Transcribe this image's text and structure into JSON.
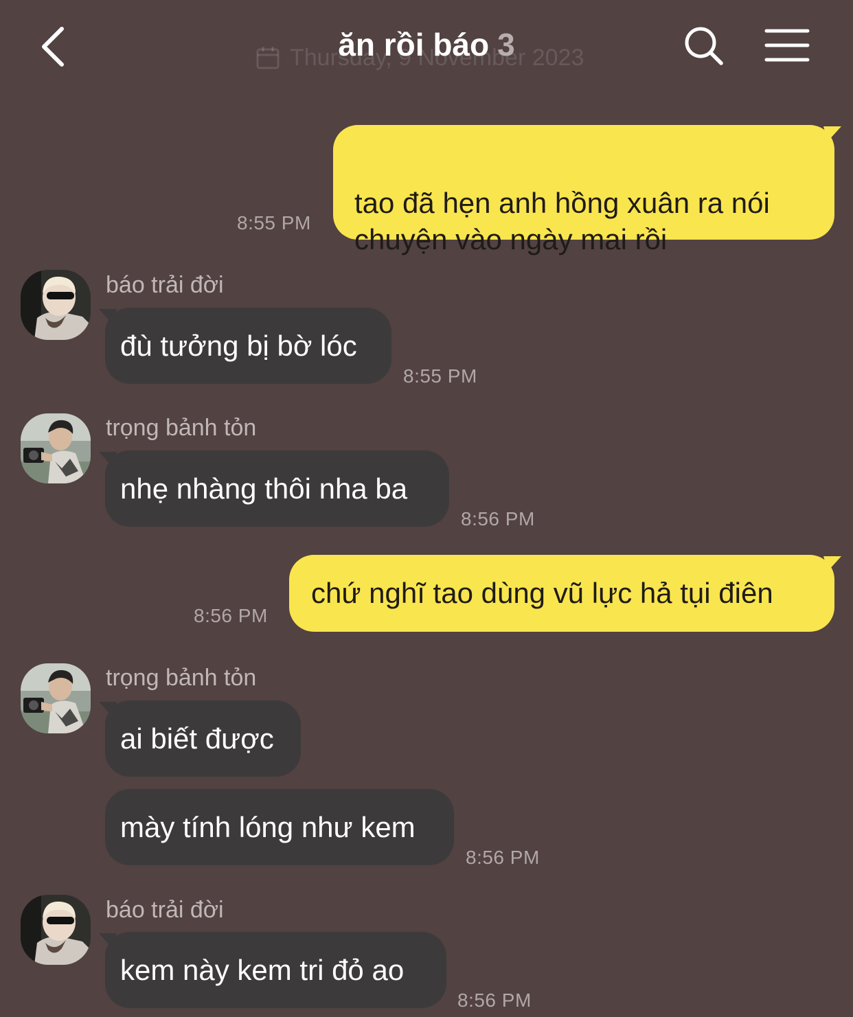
{
  "header": {
    "title": "ăn rồi báo",
    "member_count": "3",
    "date_divider": "Thursday, 9 November 2023",
    "back_icon": "chevron-left-icon",
    "search_icon": "search-icon",
    "menu_icon": "hamburger-menu-icon"
  },
  "colors": {
    "background": "#524242",
    "my_bubble": "#f9e54e",
    "other_bubble": "#3d3a3b"
  },
  "messages": [
    {
      "from": "me",
      "text": "tao đã hẹn anh hồng xuân ra nói\nchuyện vào ngày mai rồi",
      "time": "8:55 PM"
    },
    {
      "from": "báo trải đời",
      "text": "đù tưởng bị bờ lóc",
      "time": "8:55 PM"
    },
    {
      "from": "trọng bảnh tỏn",
      "text": "nhẹ nhàng thôi nha ba",
      "time": "8:56 PM"
    },
    {
      "from": "me",
      "text": "chứ nghĩ tao dùng vũ lực hả tụi điên",
      "time": "8:56 PM"
    },
    {
      "from": "trọng bảnh tỏn",
      "text": "ai biết được",
      "time": ""
    },
    {
      "from": "trọng bảnh tỏn",
      "text": "mày tính lóng như kem",
      "time": "8:56 PM"
    },
    {
      "from": "báo trải đời",
      "text": "kem này kem tri đỏ ao",
      "time": "8:56 PM"
    }
  ]
}
